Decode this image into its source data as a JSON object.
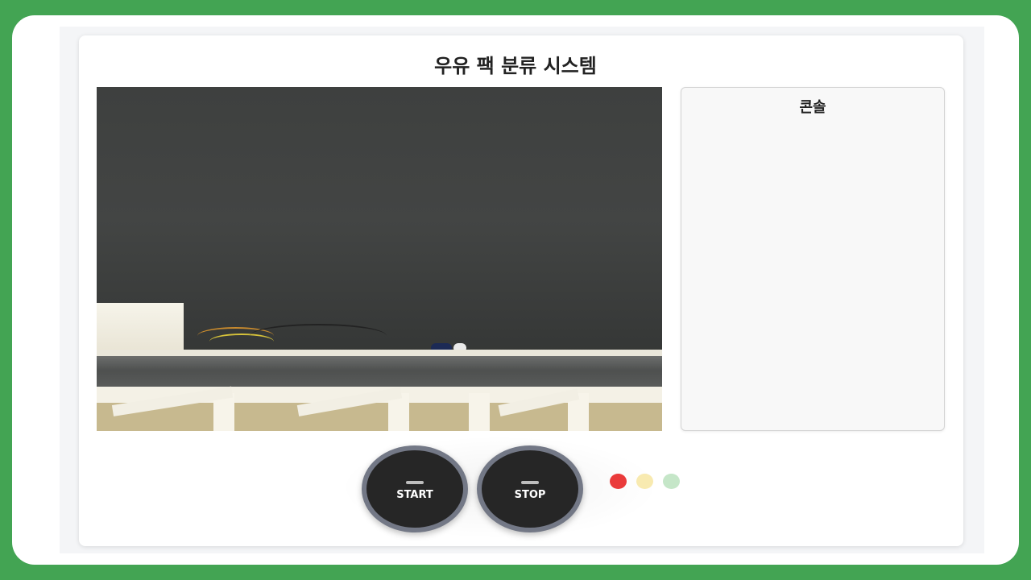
{
  "app": {
    "title": "우유 팩 분류 시스템"
  },
  "camera": {
    "feed_icon": "camera-feed"
  },
  "console": {
    "title": "콘솔",
    "lines": []
  },
  "controls": {
    "start_label": "START",
    "stop_label": "STOP"
  },
  "status_lights": [
    {
      "name": "red",
      "color": "#ea3b3b"
    },
    {
      "name": "yellow",
      "color": "#f8eab0"
    },
    {
      "name": "green",
      "color": "#c5e6c8"
    }
  ],
  "colors": {
    "frame_border": "#43a453",
    "button_face": "#262626",
    "button_ring": "#737886"
  }
}
